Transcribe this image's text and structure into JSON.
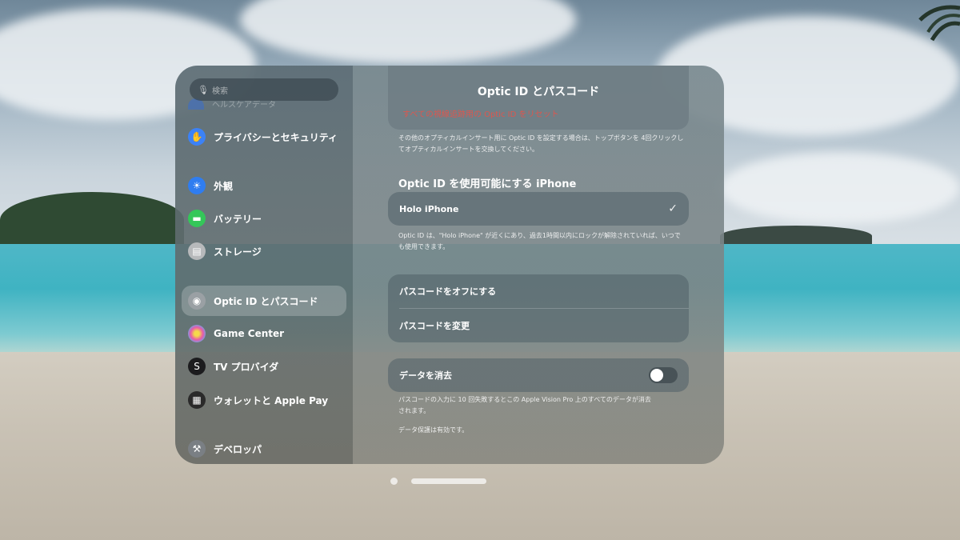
{
  "sidebar": {
    "search_placeholder": "検索",
    "faded_item": "ヘルスケアデータ",
    "items": [
      {
        "label": "プライバシーとセキュリティ",
        "icon": "hand-icon",
        "color": "#3c82f6",
        "selected": false
      },
      {
        "label": "外観",
        "icon": "sun-icon",
        "color": "#2f7df0",
        "selected": false
      },
      {
        "label": "バッテリー",
        "icon": "battery-icon",
        "color": "#34c759",
        "selected": false
      },
      {
        "label": "ストレージ",
        "icon": "storage-icon",
        "color": "#b7b9bb",
        "selected": false
      },
      {
        "label": "Optic ID とパスコード",
        "icon": "eye-icon",
        "color": "#9aa0a4",
        "selected": true
      },
      {
        "label": "Game Center",
        "icon": "game-center-icon",
        "color": "#e85aa8",
        "selected": false
      },
      {
        "label": "TV プロバイダ",
        "icon": "tv-provider-icon",
        "color": "#1c1c1e",
        "selected": false
      },
      {
        "label": "ウォレットと Apple Pay",
        "icon": "wallet-icon",
        "color": "#2a2a2a",
        "selected": false
      },
      {
        "label": "デベロッパ",
        "icon": "hammer-icon",
        "color": "#7a7f84",
        "selected": false
      }
    ]
  },
  "content": {
    "title": "Optic ID とパスコード",
    "reset_label": "すべての視線追跡用の Optic ID をリセット",
    "note_top": "その他のオプティカルインサート用に Optic ID を設定する場合は、トップボタンを 4回クリックしてオプティカルインサートを交換してください。",
    "section_title": "Optic ID を使用可能にする iPhone",
    "iphone_name": "Holo iPhone",
    "iphone_checked": true,
    "note_iphone": "Optic ID は、\"Holo iPhone\" が近くにあり、過去1時間以内にロックが解除されていれば、いつでも使用できます。",
    "passcode_off": "パスコードをオフにする",
    "passcode_change": "パスコードを変更",
    "erase_label": "データを消去",
    "erase_on": false,
    "note_erase": "パスコードの入力に 10 回失敗するとこの Apple Vision Pro 上のすべてのデータが消去されます。",
    "note_protection": "データ保護は有効です。"
  },
  "colors": {
    "accent_red": "#ff4a3d"
  }
}
